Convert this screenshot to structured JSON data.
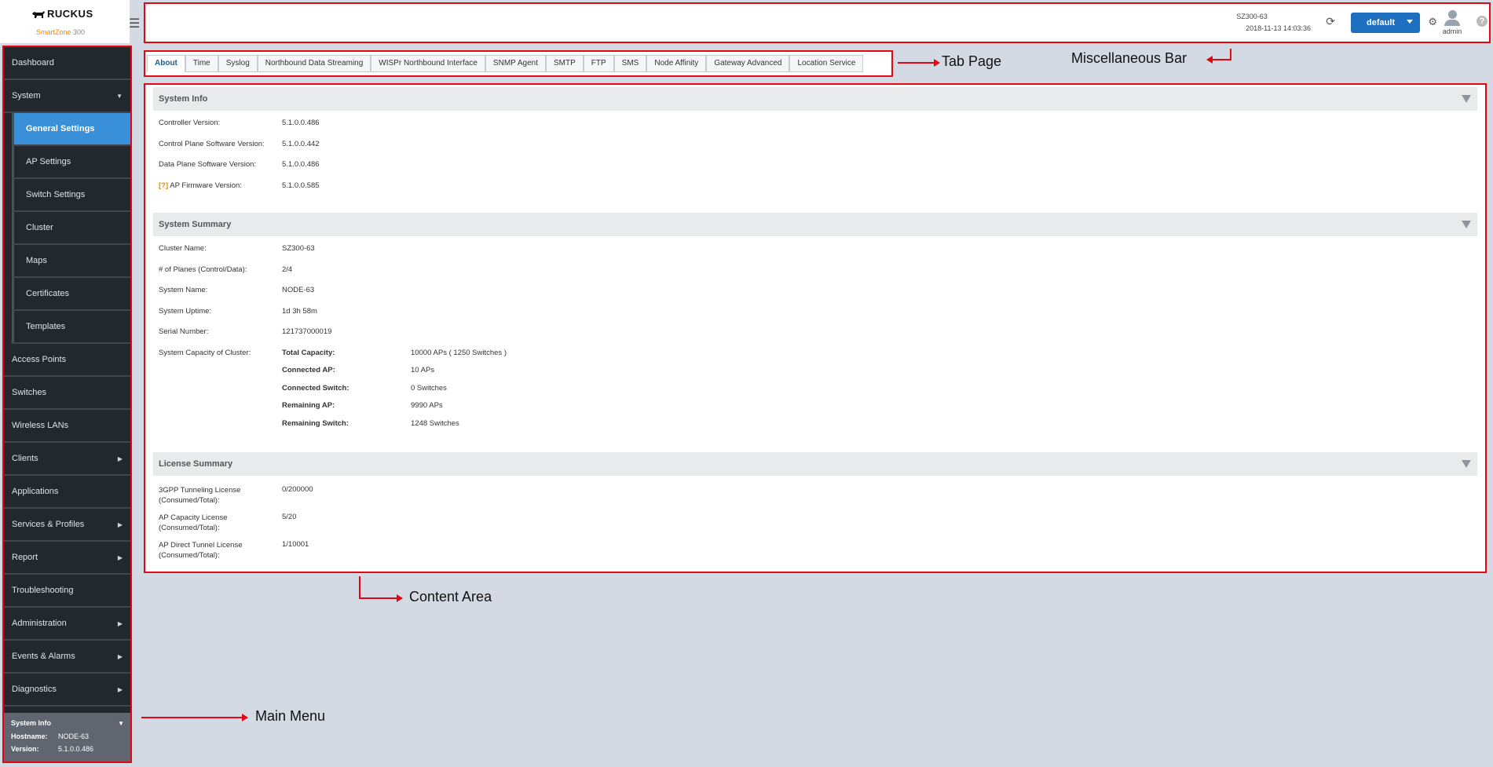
{
  "app": {
    "brand": "RUCKUS",
    "tagline": "SmartZone",
    "model": "300"
  },
  "header": {
    "node": "SZ300-63",
    "datetime": "2018-11-13  14:03:36",
    "domain": "default",
    "user": "admin",
    "help": "?"
  },
  "menu": {
    "items": [
      {
        "label": "Dashboard"
      },
      {
        "label": "System",
        "expanded": true
      },
      {
        "label": "General Settings",
        "sub": true,
        "active": true
      },
      {
        "label": "AP Settings",
        "sub": true
      },
      {
        "label": "Switch Settings",
        "sub": true
      },
      {
        "label": "Cluster",
        "sub": true
      },
      {
        "label": "Maps",
        "sub": true
      },
      {
        "label": "Certificates",
        "sub": true
      },
      {
        "label": "Templates",
        "sub": true
      },
      {
        "label": "Access Points"
      },
      {
        "label": "Switches"
      },
      {
        "label": "Wireless LANs"
      },
      {
        "label": "Clients",
        "arrow": true
      },
      {
        "label": "Applications"
      },
      {
        "label": "Services & Profiles",
        "arrow": true
      },
      {
        "label": "Report",
        "arrow": true
      },
      {
        "label": "Troubleshooting"
      },
      {
        "label": "Administration",
        "arrow": true
      },
      {
        "label": "Events & Alarms",
        "arrow": true
      },
      {
        "label": "Diagnostics",
        "arrow": true
      }
    ],
    "sysinfo": {
      "title": "System Info",
      "hostname_label": "Hostname:",
      "hostname": "NODE-63",
      "version_label": "Version:",
      "version": "5.1.0.0.486"
    }
  },
  "tabs": [
    "About",
    "Time",
    "Syslog",
    "Northbound Data Streaming",
    "WISPr Northbound Interface",
    "SNMP Agent",
    "SMTP",
    "FTP",
    "SMS",
    "Node Affinity",
    "Gateway Advanced",
    "Location Service"
  ],
  "system_info": {
    "title": "System Info",
    "rows": [
      {
        "k": "Controller Version:",
        "v": "5.1.0.0.486"
      },
      {
        "k": "Control Plane Software Version:",
        "v": "5.1.0.0.442"
      },
      {
        "k": "Data Plane Software Version:",
        "v": "5.1.0.0.486"
      },
      {
        "k": "AP Firmware Version:",
        "v": "5.1.0.0.585",
        "help": "[?]"
      }
    ]
  },
  "system_summary": {
    "title": "System Summary",
    "rows": [
      {
        "k": "Cluster Name:",
        "v": "SZ300-63"
      },
      {
        "k": "# of Planes (Control/Data):",
        "v": "2/4"
      },
      {
        "k": "System Name:",
        "v": "NODE-63"
      },
      {
        "k": "System Uptime:",
        "v": "1d 3h 58m"
      },
      {
        "k": "Serial Number:",
        "v": "121737000019"
      }
    ],
    "capacity_label": "System Capacity of Cluster:",
    "capacity": [
      {
        "k": "Total Capacity:",
        "v": "10000 APs ( 1250 Switches )"
      },
      {
        "k": "Connected AP:",
        "v": "10 APs"
      },
      {
        "k": "Connected Switch:",
        "v": "0 Switches"
      },
      {
        "k": "Remaining AP:",
        "v": "9990 APs"
      },
      {
        "k": "Remaining Switch:",
        "v": "1248 Switches"
      }
    ]
  },
  "license_summary": {
    "title": "License Summary",
    "rows": [
      {
        "k": "3GPP Tunneling License\n(Consumed/Total):",
        "v": "0/200000"
      },
      {
        "k": "AP Capacity License\n(Consumed/Total):",
        "v": "5/20"
      },
      {
        "k": "AP Direct Tunnel License\n(Consumed/Total):",
        "v": "1/10001"
      }
    ]
  },
  "annotations": {
    "tab_page": "Tab Page",
    "misc_bar": "Miscellaneous Bar",
    "content_area": "Content Area",
    "main_menu": "Main Menu"
  }
}
